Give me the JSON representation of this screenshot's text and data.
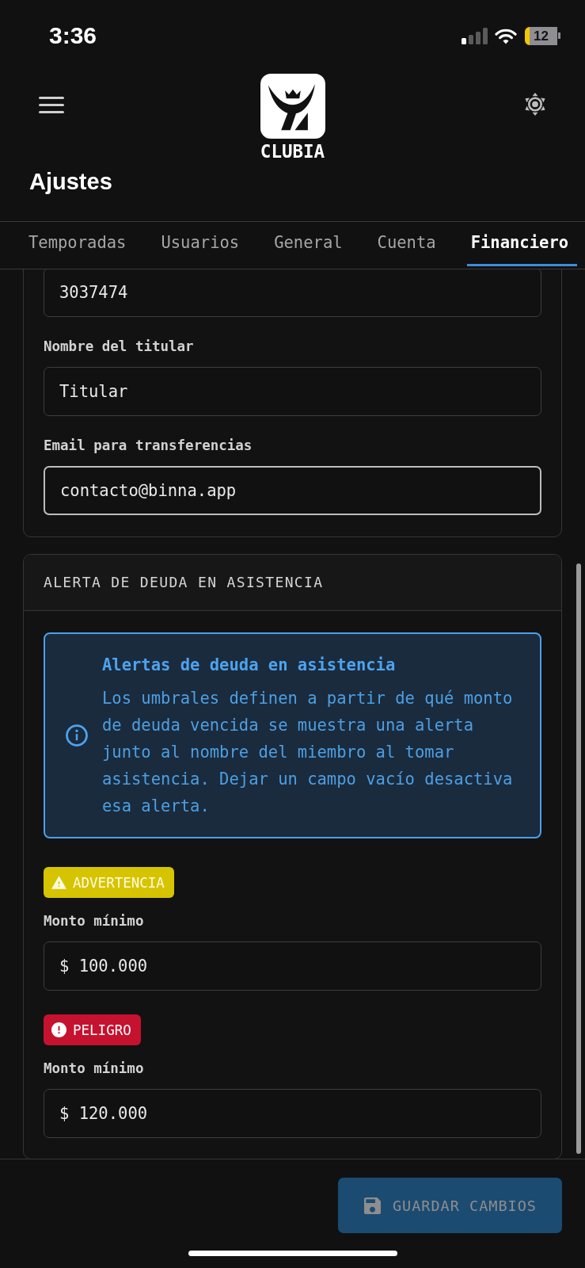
{
  "status_bar": {
    "time": "3:36",
    "battery": "12"
  },
  "header": {
    "brand": "CLUBIA"
  },
  "page_title": "Ajustes",
  "tabs": [
    {
      "label": "Temporadas",
      "selected": false
    },
    {
      "label": "Usuarios",
      "selected": false
    },
    {
      "label": "General",
      "selected": false
    },
    {
      "label": "Cuenta",
      "selected": false
    },
    {
      "label": "Financiero",
      "selected": true
    }
  ],
  "bank_card": {
    "fields": [
      {
        "value": "3037474",
        "focused": false
      },
      {
        "label": "Nombre del titular",
        "value": "Titular",
        "focused": false
      },
      {
        "label": "Email para transferencias",
        "value": "contacto@binna.app",
        "focused": true
      }
    ]
  },
  "debt_alert_card": {
    "title": "ALERTA DE DEUDA EN ASISTENCIA",
    "info": {
      "title": "Alertas de deuda en asistencia",
      "text": "Los umbrales definen a partir de qué monto de deuda vencida se muestra una alerta junto al nombre del miembro al tomar asistencia. Dejar un campo vacío desactiva esa alerta."
    },
    "thresholds": [
      {
        "kind": "warning",
        "badge": "ADVERTENCIA",
        "label": "Monto mínimo",
        "value": "$ 100.000",
        "focused": false
      },
      {
        "kind": "danger",
        "badge": "PELIGRO",
        "label": "Monto mínimo",
        "value": "$ 120.000",
        "focused": false
      }
    ]
  },
  "footer": {
    "save_button": {
      "label": "GUARDAR CAMBIOS",
      "disabled": true
    }
  }
}
